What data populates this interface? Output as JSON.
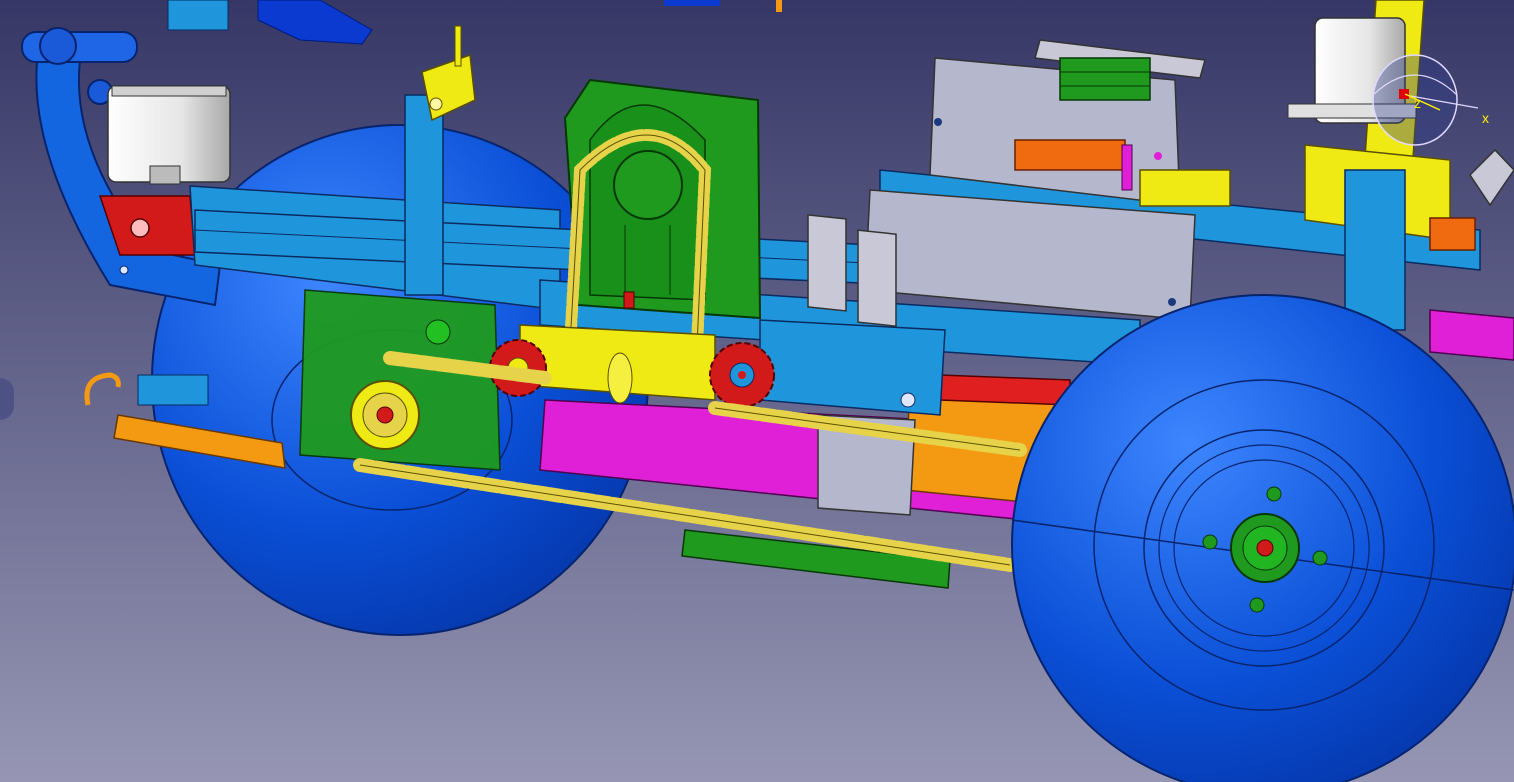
{
  "viewport": {
    "background_top": "#363766",
    "background_bottom": "#9696b4"
  },
  "compass": {
    "x_label": "x",
    "z_label": "z",
    "color": "#fff000"
  },
  "colors": {
    "wheel_blue": "#0a4fd6",
    "wheel_blue_light": "#2a74f0",
    "frame_blue": "#1f96dc",
    "frame_blue_dark": "#1570b8",
    "chain_yellow": "#e6d34a",
    "bracket_green": "#1f9a1f",
    "sprocket_red": "#d31a1a",
    "accent_magenta": "#e020d6",
    "accent_orange": "#f39a12",
    "plate_gray": "#b5b8cc",
    "yellow_part": "#f0ea14"
  },
  "icons": {
    "compass": "axis-compass-icon",
    "rear_wheel": "rear-wheel",
    "front_wheel": "front-wheel"
  }
}
